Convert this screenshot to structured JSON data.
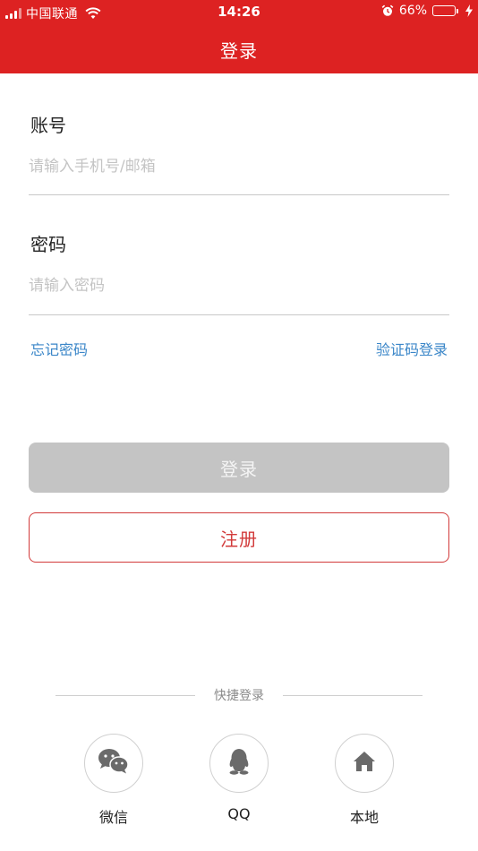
{
  "status_bar": {
    "carrier": "中国联通",
    "time": "14:26",
    "battery_percent": "66%",
    "battery_level": 0.66
  },
  "header": {
    "title": "登录"
  },
  "form": {
    "account_label": "账号",
    "account_placeholder": "请输入手机号/邮箱",
    "password_label": "密码",
    "password_placeholder": "请输入密码"
  },
  "links": {
    "forgot_password": "忘记密码",
    "code_login": "验证码登录"
  },
  "buttons": {
    "login": "登录",
    "register": "注册"
  },
  "quick_login": {
    "title": "快捷登录",
    "items": [
      {
        "label": "微信",
        "icon": "wechat-icon"
      },
      {
        "label": "QQ",
        "icon": "qq-icon"
      },
      {
        "label": "本地",
        "icon": "home-icon"
      }
    ]
  },
  "colors": {
    "brand_red": "#dd2222",
    "link_blue": "#3a86c8",
    "disabled_gray": "#c4c4c4",
    "register_red": "#d23a3a",
    "battery_green": "#4cd964"
  }
}
